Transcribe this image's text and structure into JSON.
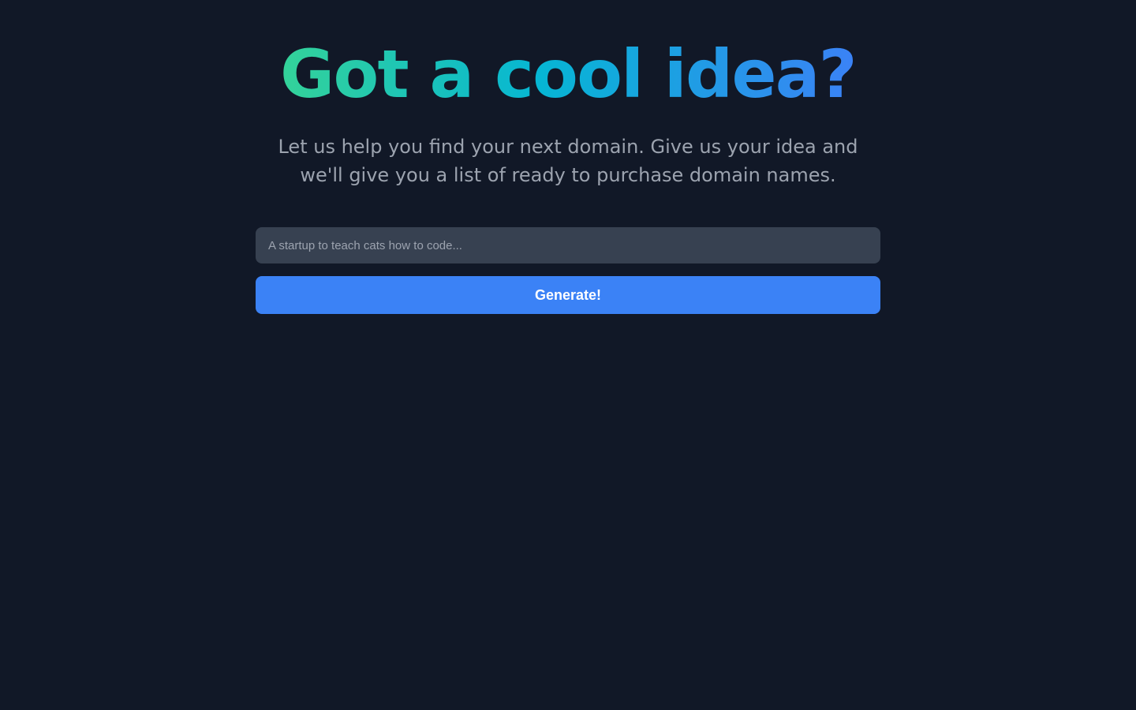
{
  "hero": {
    "title": "Got a cool idea?",
    "subtitle": "Let us help you find your next domain. Give us your idea and we'll give you a list of ready to purchase domain names."
  },
  "form": {
    "idea_input": {
      "value": "",
      "placeholder": "A startup to teach cats how to code..."
    },
    "submit_label": "Generate!"
  }
}
